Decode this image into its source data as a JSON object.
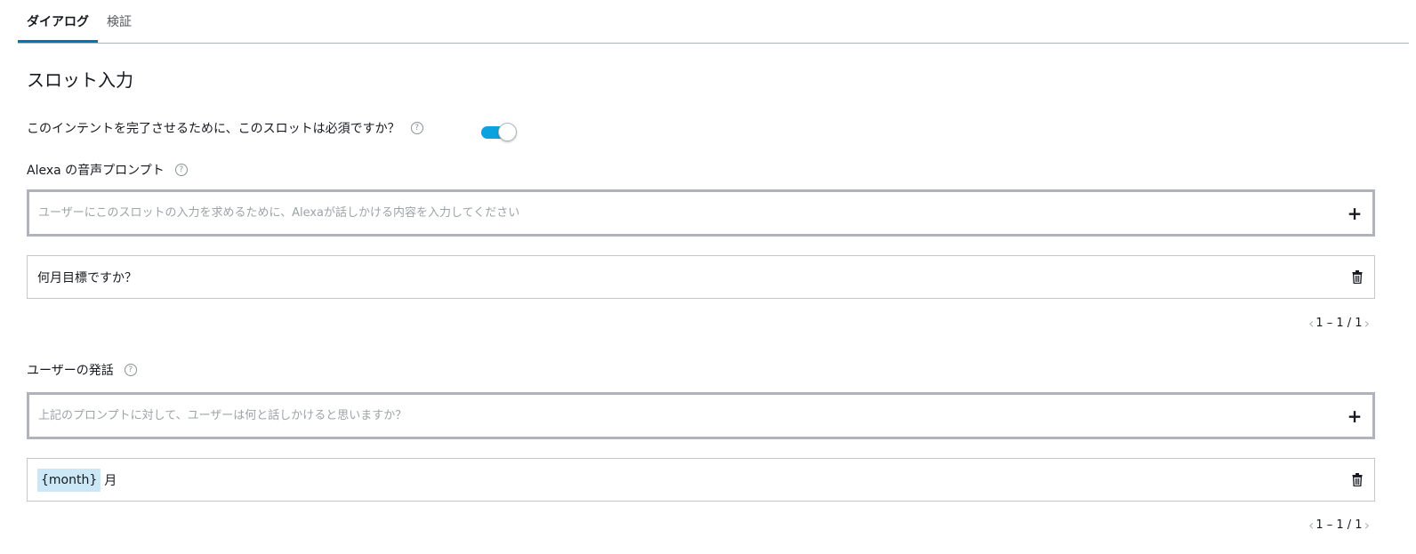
{
  "tabs": [
    {
      "label": "ダイアログ",
      "active": true
    },
    {
      "label": "検証",
      "active": false
    }
  ],
  "section_title": "スロット入力",
  "required": {
    "label": "このインテントを完了させるために、このスロットは必須ですか？",
    "help": "?",
    "enabled": true
  },
  "prompts": {
    "label": "Alexa の音声プロンプト",
    "help": "?",
    "placeholder": "ユーザーにこのスロットの入力を求めるために、Alexaが話しかける内容を入力してください",
    "add_symbol": "+",
    "items": [
      {
        "text": "何月目標ですか？"
      }
    ],
    "pagination": {
      "prev": "‹",
      "range": "1 – 1 / 1",
      "next": "›"
    }
  },
  "utterances": {
    "label": "ユーザーの発話",
    "help": "?",
    "placeholder": "上記のプロンプトに対して、ユーザーは何と話しかけると思いますか？",
    "add_symbol": "+",
    "items": [
      {
        "slot": "{month}",
        "text": "月"
      }
    ],
    "pagination": {
      "prev": "‹",
      "range": "1 – 1 / 1",
      "next": "›"
    }
  },
  "colors": {
    "accent": "#0073bb",
    "toggle_on": "#0aa3e0",
    "slot_highlight": "#cce8f7"
  }
}
